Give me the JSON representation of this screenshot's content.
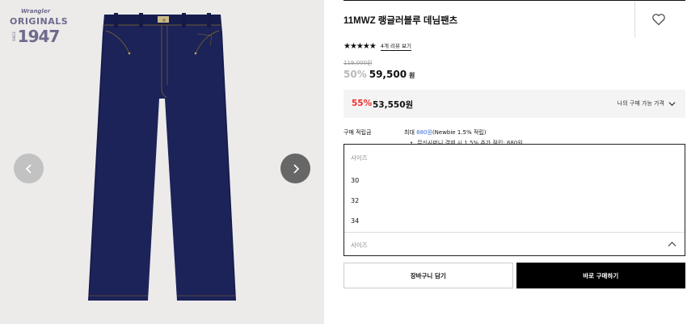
{
  "gallery": {
    "logo": {
      "brand": "Wrangler",
      "line1": "ORIGINALS",
      "since": "SINCE",
      "year": "1947"
    },
    "prev_icon": "chevron-left-icon",
    "next_icon": "chevron-right-icon"
  },
  "product": {
    "title": "11MWZ 랭글러블루 데님팬츠",
    "favorite_icon": "heart-icon",
    "stars": "★★★★★",
    "review_link": "4개 리뷰 보기",
    "original_price": "119,000원",
    "discount": "50%",
    "price": "59,500",
    "price_unit": "원"
  },
  "member": {
    "discount": "55%",
    "price": "53,550원",
    "link": "나의 구매 가능 가격"
  },
  "points": {
    "label": "구매 적립금",
    "value_prefix": "최대 ",
    "value_accent": "880원",
    "value_suffix": "(Newbie 1.5% 적립)",
    "sub": "무신사머니 결제 시 1.5% 추가 적립: 880원"
  },
  "size_dropdown": {
    "header": "사이즈",
    "options": [
      "30",
      "32",
      "34"
    ],
    "placeholder": "사이즈"
  },
  "actions": {
    "cart": "장바구니 담기",
    "buy": "바로 구매하기"
  },
  "colors": {
    "accent_red": "#f0302c",
    "accent_blue": "#3a6fd8",
    "denim": "#1c2358"
  }
}
